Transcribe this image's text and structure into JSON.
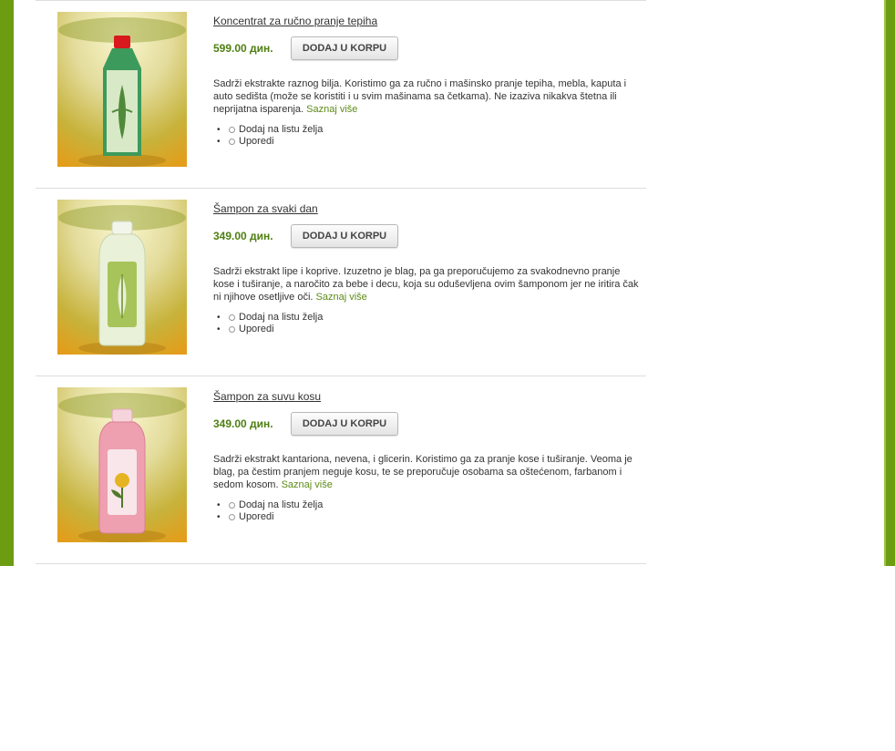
{
  "products": [
    {
      "title": "Koncentrat za ručno pranje tepiha",
      "price": "599.00 дин.",
      "cart_label": "DODAJ U KORPU",
      "description": "Sadrži ekstrakte raznog bilja. Koristimo ga za ručno i mašinsko pranje tepiha, mebla, kaputa i auto sedišta (može se koristiti i u svim mašinama sa četkama). Ne izaziva nikakva štetna ili neprijatna isparenja.",
      "more_label": "Saznaj više",
      "wishlist_label": "Dodaj na listu želja",
      "compare_label": "Uporedi",
      "bottle_color": "#3c9a5c",
      "cap_color": "#d8191d"
    },
    {
      "title": "Šampon za svaki dan",
      "price": "349.00 дин.",
      "cart_label": "DODAJ U KORPU",
      "description": "Sadrži ekstrakt lipe i koprive. Izuzetno je blag, pa ga preporučujemo za svakodnevno pranje kose i tuširanje, a naročito za bebe i decu, koja su oduševljena ovim šamponom jer ne iritira čak ni njihove osetljive oči.",
      "more_label": "Saznaj više",
      "wishlist_label": "Dodaj na listu želja",
      "compare_label": "Uporedi",
      "bottle_color": "#e9f1d8",
      "cap_color": "#f2f5ea"
    },
    {
      "title": "Šampon za suvu kosu",
      "price": "349.00 дин.",
      "cart_label": "DODAJ U KORPU",
      "description": "Sadrži ekstrakt kantariona, nevena, i glicerin. Koristimo ga za pranje kose i tuširanje. Veoma je blag, pa čestim pranjem neguje kosu, te se preporučuje osobama sa oštećenom, farbanom i sedom kosom.",
      "more_label": "Saznaj više",
      "wishlist_label": "Dodaj na listu želja",
      "compare_label": "Uporedi",
      "bottle_color": "#ee9fb0",
      "cap_color": "#f6d4dc"
    }
  ],
  "colors": {
    "frame_green": "#6c9c12",
    "price_green": "#4e7f11",
    "link_green": "#5d8b16"
  }
}
